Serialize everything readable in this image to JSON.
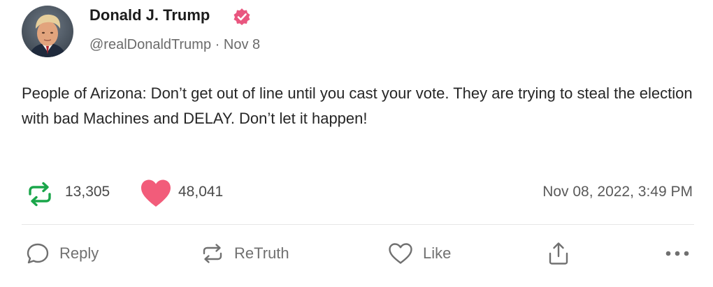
{
  "author": {
    "name": "Donald J. Trump",
    "handle": "@realDonaldTrump",
    "separator": "·",
    "date_short": "Nov 8",
    "verified": true
  },
  "post": {
    "text": "People of Arizona: Don’t get out of line until you cast your vote. They are trying to steal the election with bad Machines and DELAY. Don’t let it happen!"
  },
  "stats": {
    "retruths": "13,305",
    "likes": "48,041",
    "timestamp": "Nov 08, 2022, 3:49 PM"
  },
  "actions": {
    "reply_label": "Reply",
    "retruth_label": "ReTruth",
    "like_label": "Like"
  },
  "icons": {
    "verified": "verified-badge-icon",
    "retruth_count": "retruth-icon",
    "like_count": "heart-icon",
    "reply": "speech-bubble-icon",
    "retruth": "retruth-icon",
    "like": "heart-outline-icon",
    "share": "share-icon",
    "more": "more-dots-icon"
  },
  "colors": {
    "verified": "#e9567f",
    "retruth_green": "#1aa64a",
    "heart_pink": "#f25c7a",
    "muted_text": "#6b6b6b"
  }
}
